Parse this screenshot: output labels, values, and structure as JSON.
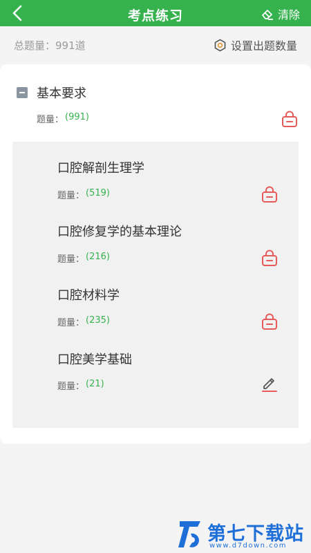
{
  "header": {
    "title": "考点练习",
    "clear_label": "清除"
  },
  "summary": {
    "total": "总题量：991道",
    "settings_label": "设置出题数量"
  },
  "category": {
    "title": "基本要求",
    "count_label": "题量：",
    "count_value": "(991)"
  },
  "subcategories": [
    {
      "title": "口腔解剖生理学",
      "count_label": "题量：",
      "count_value": "(519)",
      "icon": "lock-icon"
    },
    {
      "title": "口腔修复学的基本理论",
      "count_label": "题量：",
      "count_value": "(216)",
      "icon": "lock-icon"
    },
    {
      "title": "口腔材料学",
      "count_label": "题量：",
      "count_value": "(235)",
      "icon": "lock-icon"
    },
    {
      "title": "口腔美学基础",
      "count_label": "题量：",
      "count_value": "(21)",
      "icon": "pencil-icon"
    }
  ],
  "watermark": {
    "text": "第七下载站",
    "url": "www.d7down.com"
  },
  "colors": {
    "brand_green": "#35b24d",
    "lock_red": "#e85a5a",
    "watermark_blue": "#1f6fd8"
  }
}
